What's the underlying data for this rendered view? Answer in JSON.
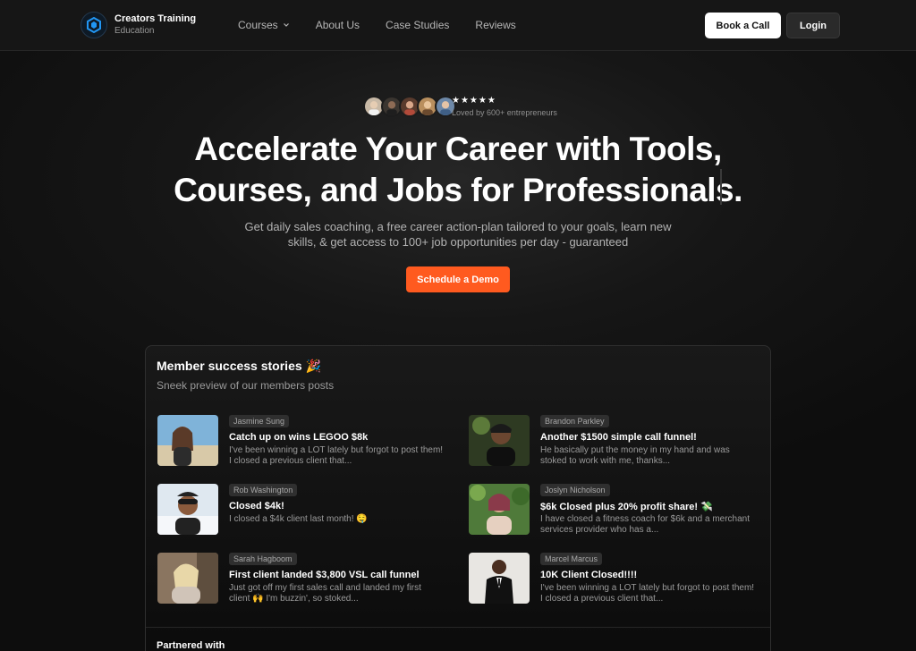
{
  "brand": {
    "name": "Creators Training",
    "sub": "Education"
  },
  "nav": {
    "links": [
      "Courses",
      "About Us",
      "Case Studies",
      "Reviews"
    ],
    "book_call": "Book a Call",
    "login": "Login"
  },
  "hero": {
    "stars": "★★★★★",
    "rating": 5,
    "loved": "Loved by 600+ entrepreneurs",
    "title_line1": "Accelerate Your Career with Tools,",
    "title_line2": "Courses, and Jobs for Professionals.",
    "subtitle": "Get daily sales coaching, a free career action-plan tailored to your goals, learn new skills, & get access to 100+ job opportunities per day - guaranteed",
    "cta": "Schedule a Demo"
  },
  "stories": {
    "title": "Member success stories 🎉",
    "subtitle": "Sneek preview of our members posts",
    "items": [
      {
        "author": "Jasmine Sung",
        "title": "Catch up on wins LEGOO $8k",
        "body": "I've been winning a LOT lately but forgot to post them!  I closed a previous client that..."
      },
      {
        "author": "Brandon Parkley",
        "title": "Another $1500 simple call funnel!",
        "body": "He basically put the money in my hand and was stoked to work with me, thanks..."
      },
      {
        "author": "Rob Washington",
        "title": "Closed $4k!",
        "body": "I closed a $4k client last month! 🤤"
      },
      {
        "author": "Joslyn Nicholson",
        "title": "$6k Closed plus 20% profit share! 💸",
        "body": "I have closed a fitness coach for $6k and a merchant services provider who has a..."
      },
      {
        "author": "Sarah Hagboom",
        "title": "First client landed $3,800 VSL call funnel",
        "body": "Just got off my first sales call and landed my first client 🙌 I'm buzzin', so stoked..."
      },
      {
        "author": "Marcel Marcus",
        "title": "10K Client Closed!!!!",
        "body": "I've been winning a LOT lately but forgot to post them!  I closed a previous client that..."
      }
    ]
  },
  "partnered": "Partnered with",
  "colors": {
    "accent": "#ff5a1f",
    "logo": "#1e88e5"
  }
}
